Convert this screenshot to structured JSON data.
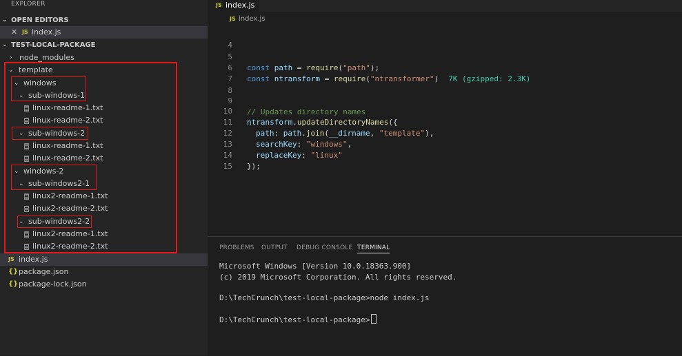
{
  "sidebar": {
    "title": "EXPLORER",
    "open_editors": {
      "header": "OPEN EDITORS",
      "items": [
        {
          "label": "index.js",
          "icon": "JS"
        }
      ]
    },
    "project": {
      "header": "TEST-LOCAL-PACKAGE",
      "tree": [
        {
          "label": "node_modules",
          "type": "folder",
          "expanded": false
        },
        {
          "label": "template",
          "type": "folder",
          "expanded": true
        },
        {
          "label": "windows",
          "type": "folder",
          "expanded": true
        },
        {
          "label": "sub-windows-1",
          "type": "folder",
          "expanded": true
        },
        {
          "label": "linux-readme-1.txt",
          "type": "file"
        },
        {
          "label": "linux-readme-2.txt",
          "type": "file"
        },
        {
          "label": "sub-windows-2",
          "type": "folder",
          "expanded": true
        },
        {
          "label": "linux-readme-1.txt",
          "type": "file"
        },
        {
          "label": "linux-readme-2.txt",
          "type": "file"
        },
        {
          "label": "windows-2",
          "type": "folder",
          "expanded": true
        },
        {
          "label": "sub-windows2-1",
          "type": "folder",
          "expanded": true
        },
        {
          "label": "linux2-readme-1.txt",
          "type": "file"
        },
        {
          "label": "linux2-readme-2.txt",
          "type": "file"
        },
        {
          "label": "sub-windows2-2",
          "type": "folder",
          "expanded": true
        },
        {
          "label": "linux2-readme-1.txt",
          "type": "file"
        },
        {
          "label": "linux2-readme-2.txt",
          "type": "file"
        },
        {
          "label": "index.js",
          "type": "js"
        },
        {
          "label": "package.json",
          "type": "json"
        },
        {
          "label": "package-lock.json",
          "type": "json"
        }
      ]
    },
    "icons": {
      "js": "JS",
      "json": "{}"
    }
  },
  "editor": {
    "tab": {
      "label": "index.js",
      "icon": "JS"
    },
    "breadcrumb": {
      "label": "index.js",
      "icon": "JS"
    },
    "line_numbers": [
      "4",
      "5",
      "6",
      "7",
      "8",
      "9",
      "10",
      "11",
      "12",
      "13",
      "14",
      "15"
    ],
    "code": {
      "l5_a": "const",
      "l5_b": " path",
      "l5_c": " = ",
      "l5_d": "require",
      "l5_e": "(",
      "l5_f": "\"path\"",
      "l5_g": ");",
      "l6_a": "const",
      "l6_b": " ntransform",
      "l6_c": " = ",
      "l6_d": "require",
      "l6_e": "(",
      "l6_f": "\"ntransformer\"",
      "l6_g": ")",
      "l6_hint": "7K (gzipped: 2.3K)",
      "l9": "// Updates directory names",
      "l10_a": "ntransform",
      "l10_b": ".",
      "l10_c": "updateDirectoryNames",
      "l10_d": "({",
      "l11_a": "path",
      "l11_b": ": ",
      "l11_c": "path",
      "l11_d": ".",
      "l11_e": "join",
      "l11_f": "(",
      "l11_g": "__dirname",
      "l11_h": ", ",
      "l11_i": "\"template\"",
      "l11_j": "),",
      "l12_a": "searchKey",
      "l12_b": ": ",
      "l12_c": "\"windows\"",
      "l12_d": ",",
      "l13_a": "replaceKey",
      "l13_b": ": ",
      "l13_c": "\"linux\"",
      "l14": "});"
    }
  },
  "panel": {
    "tabs": [
      "PROBLEMS",
      "OUTPUT",
      "DEBUG CONSOLE",
      "TERMINAL"
    ],
    "active_tab": "TERMINAL",
    "terminal_lines": [
      "Microsoft Windows [Version 10.0.18363.900]",
      "(c) 2019 Microsoft Corporation. All rights reserved.",
      "D:\\TechCrunch\\test-local-package>node index.js",
      "D:\\TechCrunch\\test-local-package>"
    ]
  },
  "colors": {
    "highlight": "#e51a1a",
    "js_icon": "#cbcb41"
  }
}
